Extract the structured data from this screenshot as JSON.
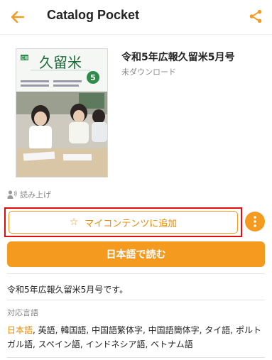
{
  "appbar": {
    "title": "Catalog Pocket",
    "back_icon": "arrow-left-icon",
    "share_icon": "share-icon",
    "accent": "#F39A1F"
  },
  "document": {
    "title": "令和5年広報久留米5月号",
    "status": "未ダウンロード",
    "cover": {
      "badge": "広報",
      "masthead": "久留米",
      "issue_number": "5"
    }
  },
  "read_aloud": {
    "label": "読み上げ",
    "icon": "speaker-person-icon"
  },
  "actions": {
    "add_label": "マイコンテンツに追加",
    "add_icon": "star-outline-icon",
    "more_icon": "more-vertical-icon",
    "read_label": "日本語で読む",
    "highlight_color": "#E00D0D"
  },
  "description": "令和5年広報久留米5月号です。",
  "languages": {
    "heading": "対応言語",
    "items": [
      "日本語",
      "英語",
      "韓国語",
      "中国語繁体字",
      "中国語簡体字",
      "タイ語",
      "ポルトガル語",
      "スペイン語",
      "インドネシア語",
      "ベトナム語"
    ],
    "selected": "日本語"
  }
}
